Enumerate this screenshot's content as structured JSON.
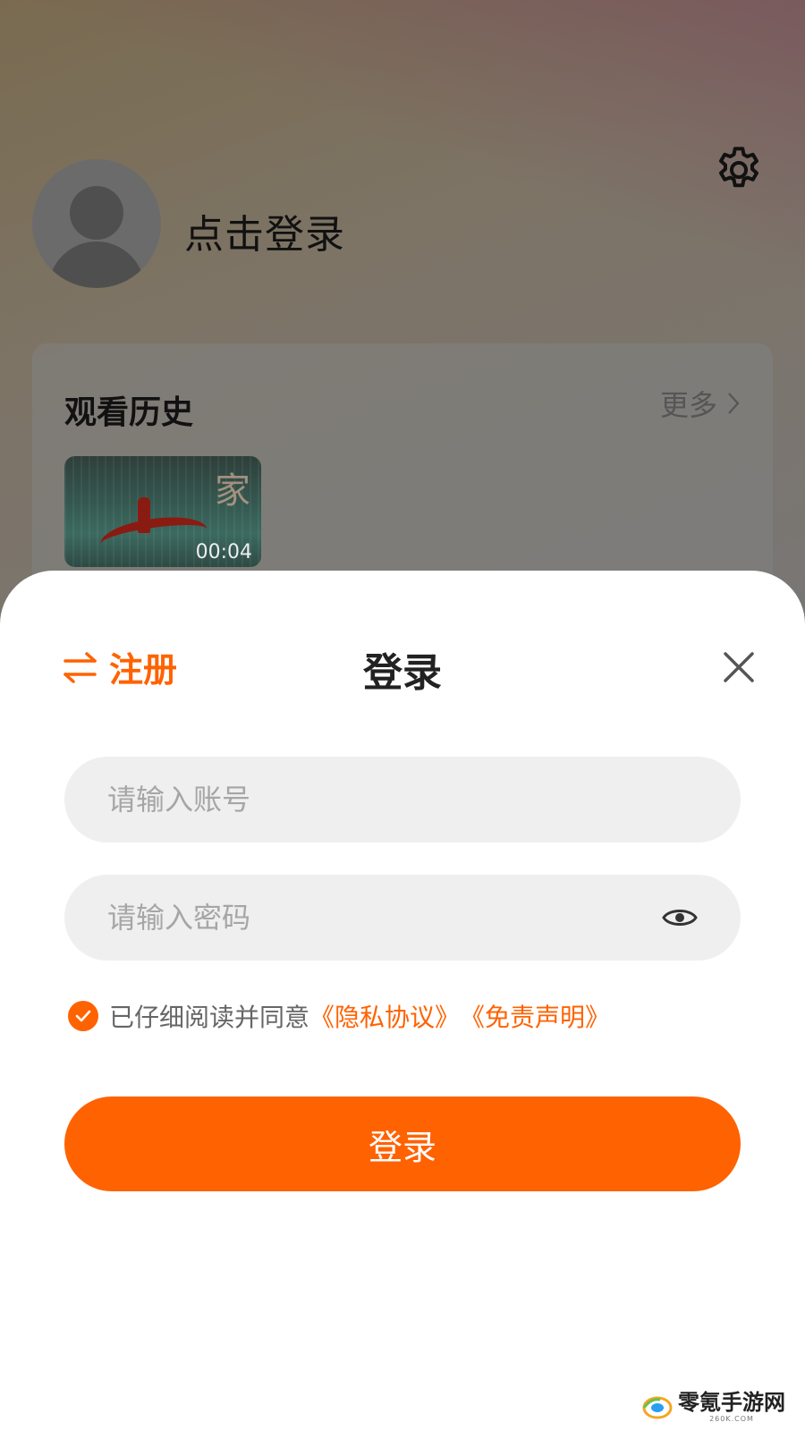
{
  "profile": {
    "login_prompt": "点击登录"
  },
  "history": {
    "title": "观看历史",
    "more_label": "更多",
    "items": [
      {
        "duration": "00:04",
        "thumb_glyph": "家"
      }
    ]
  },
  "sheet": {
    "register_label": "注册",
    "title": "登录",
    "account_placeholder": "请输入账号",
    "password_placeholder": "请输入密码",
    "agree_checked": true,
    "agree_text": "已仔细阅读并同意",
    "privacy_link": "《隐私协议》",
    "disclaimer_link": "《免责声明》",
    "login_button": "登录"
  },
  "watermark": {
    "main": "零氪手游网",
    "sub": "260K.COM"
  },
  "colors": {
    "accent": "#ff6200",
    "input_bg": "#efefef"
  }
}
